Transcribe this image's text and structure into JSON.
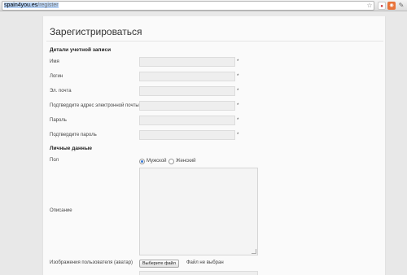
{
  "browser": {
    "url_host": "spain4you.es",
    "url_path": "/register"
  },
  "page": {
    "title": "Зарегистрироваться"
  },
  "account": {
    "section_title": "Детали учетной записи",
    "fields": [
      {
        "label": "Имя",
        "value": "",
        "required": "*"
      },
      {
        "label": "Логин",
        "value": "",
        "required": "*"
      },
      {
        "label": "Эл. почта",
        "value": "",
        "required": "*"
      },
      {
        "label": "Подтвердите адрес электронной почты",
        "value": "",
        "required": "*"
      },
      {
        "label": "Пароль",
        "value": "",
        "required": "*"
      },
      {
        "label": "Подтвердите пароль",
        "value": "",
        "required": "*"
      }
    ]
  },
  "personal": {
    "section_title": "Личные данные",
    "gender_label": "Пол",
    "gender_options": [
      {
        "label": "Мужской",
        "checked": true
      },
      {
        "label": "Женский",
        "checked": false
      }
    ],
    "description_label": "Описание",
    "description_value": "",
    "avatar_label": "Изображения пользователя (аватар)",
    "avatar_button": "Выберите файл",
    "avatar_status": "Файл не выбран"
  }
}
